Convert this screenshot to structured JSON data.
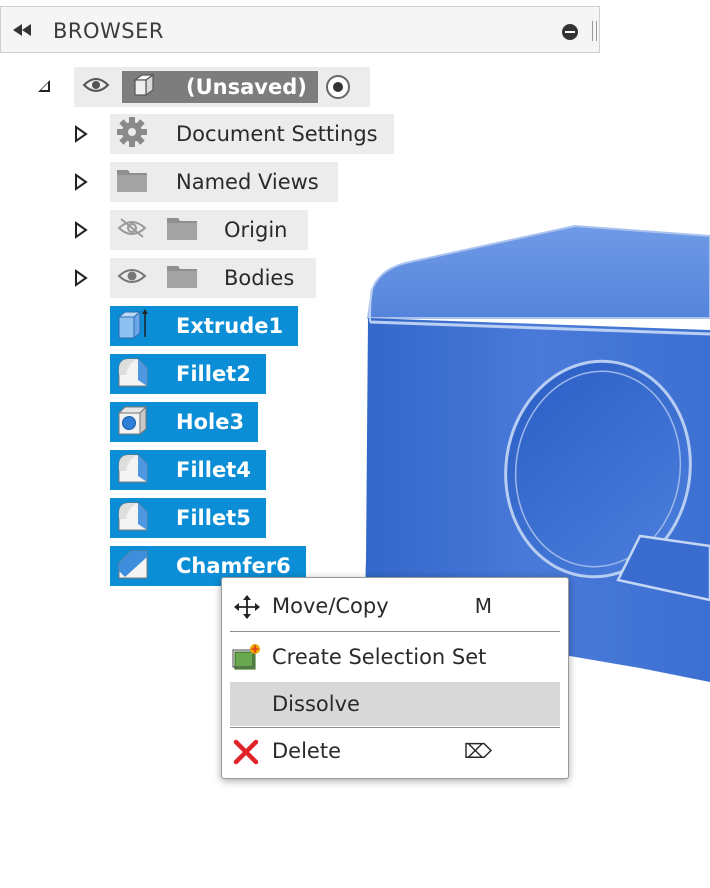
{
  "browser": {
    "title": "BROWSER"
  },
  "tree": {
    "root_label": "(Unsaved)",
    "folders": [
      {
        "label": "Document Settings",
        "icon": "gear-icon"
      },
      {
        "label": "Named Views",
        "icon": "folder-icon"
      },
      {
        "label": "Origin",
        "icon": "folder-icon",
        "visibility": "hidden"
      },
      {
        "label": "Bodies",
        "icon": "folder-icon",
        "visibility": "visible"
      }
    ],
    "features": [
      {
        "label": "Extrude1",
        "icon": "extrude-icon"
      },
      {
        "label": "Fillet2",
        "icon": "fillet-icon"
      },
      {
        "label": "Hole3",
        "icon": "hole-icon"
      },
      {
        "label": "Fillet4",
        "icon": "fillet-icon"
      },
      {
        "label": "Fillet5",
        "icon": "fillet-icon"
      },
      {
        "label": "Chamfer6",
        "icon": "chamfer-icon"
      }
    ]
  },
  "context_menu": {
    "items": [
      {
        "label": "Move/Copy",
        "shortcut": "M",
        "icon": "move-arrows-icon"
      },
      {
        "label": "Create Selection Set",
        "shortcut": "",
        "icon": "selection-set-icon"
      },
      {
        "label": "Dissolve",
        "shortcut": "",
        "icon": ""
      },
      {
        "label": "Delete",
        "shortcut": "⌦",
        "icon": "red-x-icon"
      }
    ]
  },
  "colors": {
    "selected_feature": "#0b8ed6",
    "model_blue": "#3f78d6",
    "menu_highlight": "#d8d8d8"
  }
}
